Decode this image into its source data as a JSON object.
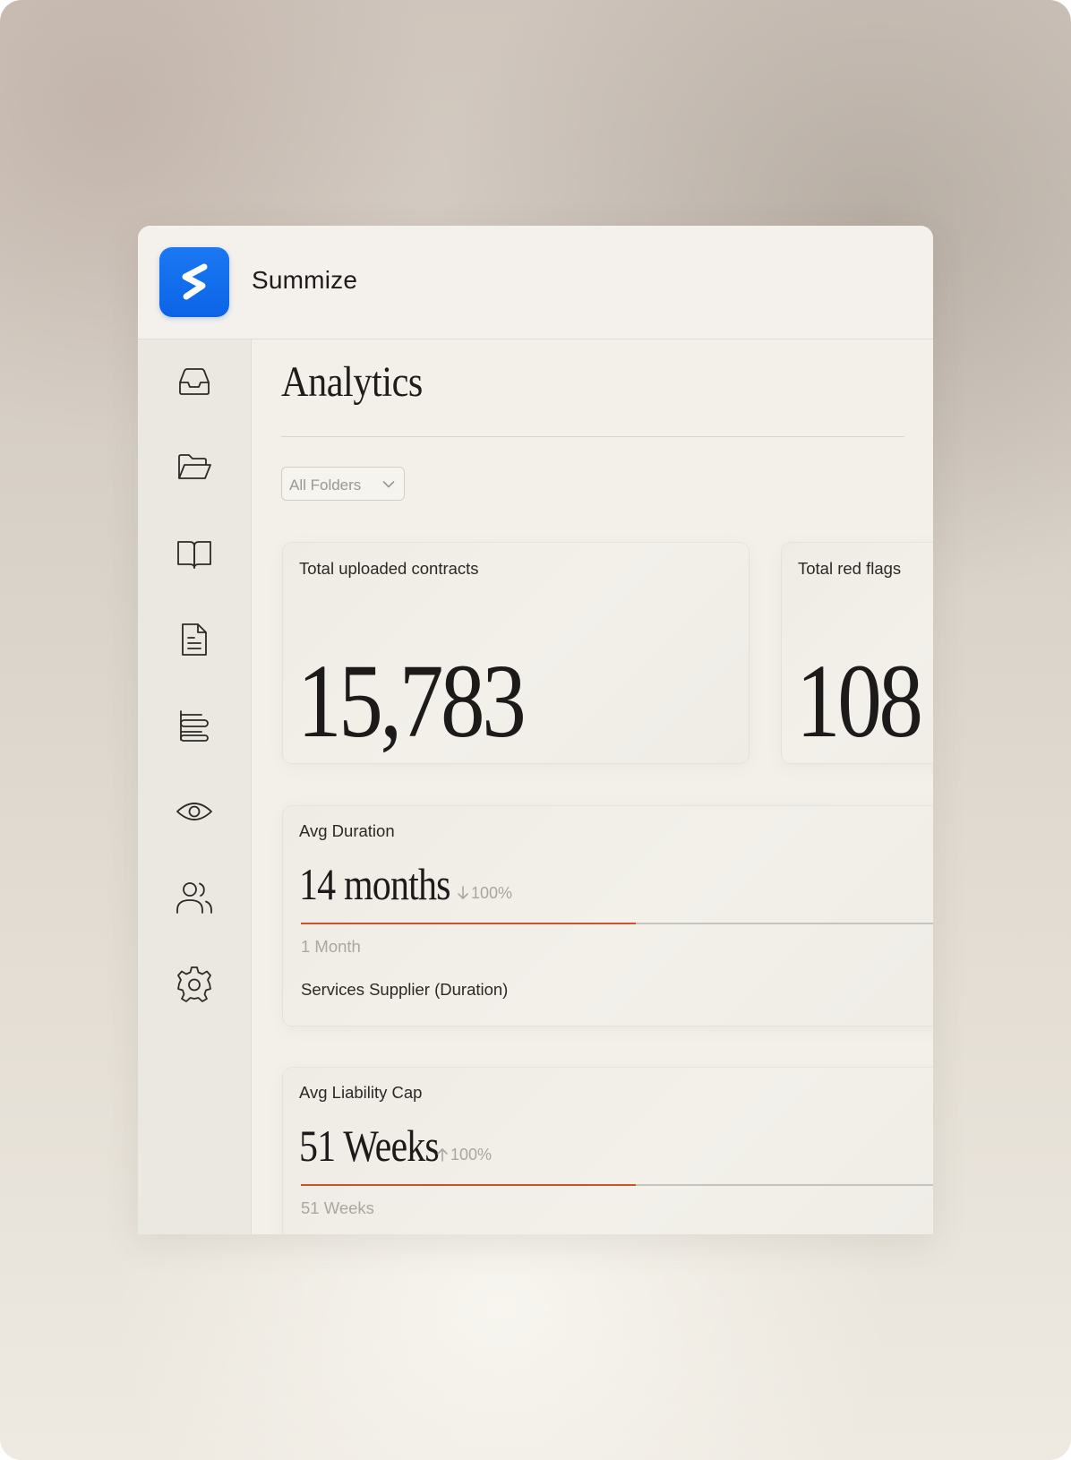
{
  "app": {
    "brand_name": "Summize",
    "brand_color": "#0b64e6"
  },
  "sidebar": {
    "items": [
      {
        "icon": "inbox-icon"
      },
      {
        "icon": "folder-open-icon"
      },
      {
        "icon": "book-open-icon"
      },
      {
        "icon": "document-icon"
      },
      {
        "icon": "align-left-icon"
      },
      {
        "icon": "eye-icon"
      },
      {
        "icon": "users-icon"
      },
      {
        "icon": "gear-icon"
      }
    ]
  },
  "main": {
    "title": "Analytics",
    "folder_filter": {
      "value": "All Folders"
    },
    "stats": [
      {
        "label": "Total uploaded contracts",
        "value": "15,783"
      },
      {
        "label": "Total red flags",
        "value": "108"
      }
    ],
    "metrics": [
      {
        "label": "Avg Duration",
        "value": "14 months",
        "delta": "100%",
        "delta_direction": "down",
        "progress": 0.48,
        "sub_value": "1 Month",
        "sub_label": "Services Supplier (Duration)"
      },
      {
        "label": "Avg Liability Cap",
        "value": "51 Weeks",
        "delta": "100%",
        "delta_direction": "up",
        "progress": 0.48,
        "sub_value": "51 Weeks"
      }
    ]
  },
  "colors": {
    "accent_progress": "#c8532e",
    "muted_text": "#aaa7a0"
  }
}
